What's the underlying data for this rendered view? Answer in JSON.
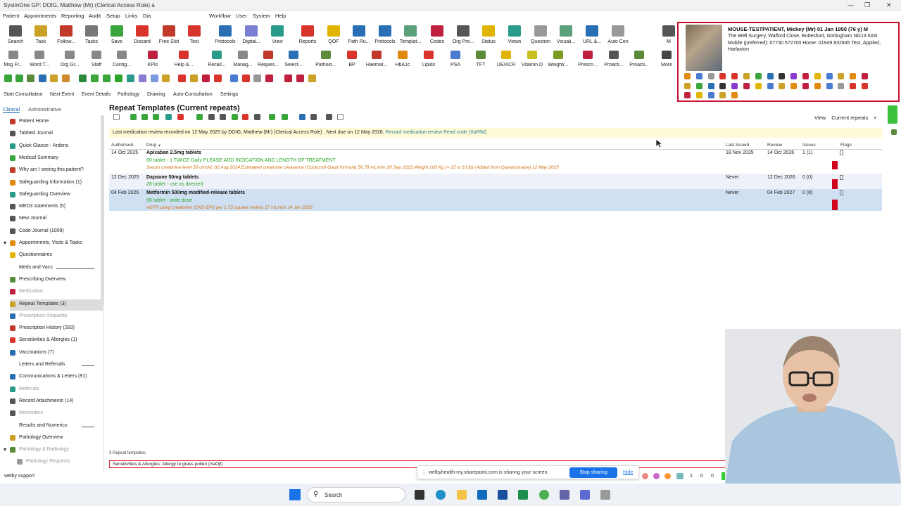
{
  "window": {
    "title": "SystmOne GP: DOIG, Matthew (Mr) (Clerical Access Role) a"
  },
  "menu": [
    "Patient",
    "Appointments",
    "Reporting",
    "Audit",
    "Setup",
    "Links",
    "Dia",
    "Workflow",
    "User",
    "System",
    "Help"
  ],
  "toolbar1": [
    "Search",
    "Task",
    "Follow...",
    "Tasks",
    "Save",
    "Discard",
    "Free Slot",
    "Test",
    "Protocols",
    "Digital...",
    "View",
    "Reports",
    "QOF",
    "Path Ru...",
    "Protocols",
    "Templat...",
    "Codes",
    "Org Pre...",
    "Status",
    "Views",
    "Question",
    "Visuali...",
    "URL &...",
    "Auto Con",
    "M"
  ],
  "toolbar2": [
    "Msg Fr...",
    "Word T...",
    "Org Gr...",
    "Staff",
    "Config...",
    "KPIs",
    "Help &...",
    "Recall...",
    "Manag...",
    "Reques...",
    "Select...",
    "Patholo...",
    "BP",
    "Haemat...",
    "HbA1c",
    "Lipids",
    "PSA",
    "TFT",
    "UE/ACR",
    "Vitamin D",
    "Weight/...",
    "Prescri...",
    "Proacti...",
    "Proacti...",
    "More"
  ],
  "consult_bar": [
    "Start Consultation",
    "Next Event",
    "Event Details",
    "Pathology",
    "Drawing",
    "Auto-Consultation",
    "Settings"
  ],
  "patient": {
    "name": "MOUSE-TESTPATIENT, Mickey (Mr) 01 Jan 1950 (76 y) M",
    "address": "The Well Surgery, Walford Close, Bottesford, Nottingham NG13 0AN",
    "phones": "Mobile (preferred): 07730 572700 Home: 01949 832845  Test, Applied, Harlaxton"
  },
  "nav": {
    "tabs": [
      "Clinical",
      "Administrative"
    ],
    "items": [
      {
        "label": "Patient Home"
      },
      {
        "label": "Tabbed Journal"
      },
      {
        "label": "Quick Glance - Ardens"
      },
      {
        "label": "Medical Summary"
      },
      {
        "label": "Why am I seeing this patient?"
      },
      {
        "label": "Safeguarding Information (1)"
      },
      {
        "label": "Safeguarding Overview"
      },
      {
        "label": "MED3 statements (5)"
      },
      {
        "label": "New Journal"
      },
      {
        "label": "Code Journal (1009)"
      },
      {
        "label": "Appointments, Visits & Tasks"
      },
      {
        "label": "Questionnaires"
      },
      {
        "label": "Meds and Vacs"
      },
      {
        "label": "Prescribing Overview"
      },
      {
        "label": "Medication"
      },
      {
        "label": "Repeat Templates (3)"
      },
      {
        "label": "Prescription Requests"
      },
      {
        "label": "Prescription History (283)"
      },
      {
        "label": "Sensitivities & Allergies (1)"
      },
      {
        "label": "Vaccinations (7)"
      },
      {
        "label": "Letters and Referrals"
      },
      {
        "label": "Communications & Letters (91)"
      },
      {
        "label": "Referrals"
      },
      {
        "label": "Record Attachments (14)"
      },
      {
        "label": "Reminders"
      },
      {
        "label": "Results and Numerics"
      },
      {
        "label": "Pathology Overview"
      },
      {
        "label": "Pathology & Radiology"
      },
      {
        "label": "Pathology Requests"
      }
    ]
  },
  "main": {
    "title": "Repeat Templates (Current repeats)",
    "view_label": "View",
    "view_value": "Current repeats",
    "banner_text": "Last medication review recorded on 12 May 2025 by DOIG, Matthew (Mr) (Clerical Access Role) . Next due on 12 May 2026.",
    "banner_link": "Record medication review Read code (XaF8d)",
    "columns": {
      "authorised": "Authorised",
      "drug": "Drug",
      "last_issued": "Last Issued",
      "review": "Review",
      "issues": "Issues",
      "flags": "Flags"
    },
    "rows": [
      {
        "authorised": "14 Oct 2025",
        "drug": "Apixaban 2.5mg tablets",
        "dose": "60 tablet - 1 TWICE Daily PLEASE ADD INDICATION AND LENGTH OF TREATMENT",
        "note": "Serum creatinine level 50 umol/L 02 Aug 2024,Estimated creatinine clearance (Cockcroft-Gault formula) 56.78 mL/min 28 Sep 2023,Weight 100 Kg (= 15 st 10 lb) (Added from Questionnaire) 12 May 2025",
        "last_issued": "18 Nov 2025",
        "review": "14 Oct 2026",
        "issues": "1 (1)"
      },
      {
        "authorised": "12 Dec 2025",
        "drug": "Dapsone 50mg tablets",
        "dose": "28 tablet - use as directed",
        "note": "",
        "last_issued": "Never",
        "review": "12 Dec 2026",
        "issues": "0 (0)"
      },
      {
        "authorised": "04 Feb 2026",
        "drug": "Metformin 500mg modified-release tablets",
        "dose": "56 tablet - write dose",
        "note": "eGFR using creatinine (CKD-EPI) per 1.73 square metres 27 mL/min 14 Jan 2026",
        "last_issued": "Never",
        "review": "04 Feb 2027",
        "issues": "0 (0)"
      }
    ],
    "count": "3 Repeat templates",
    "sensitivities": "Sensitivities & Allergies: Allergy to grass pollen (XaOjf)"
  },
  "status": {
    "user": "welby support",
    "nums": [
      "0",
      "0",
      "0",
      "1",
      "0",
      "0"
    ]
  },
  "share": {
    "text": "welbyhealth-my.sharepoint.com is sharing your screen.",
    "stop": "Stop sharing",
    "hide": "Hide"
  },
  "taskbar": {
    "search": "Search"
  }
}
